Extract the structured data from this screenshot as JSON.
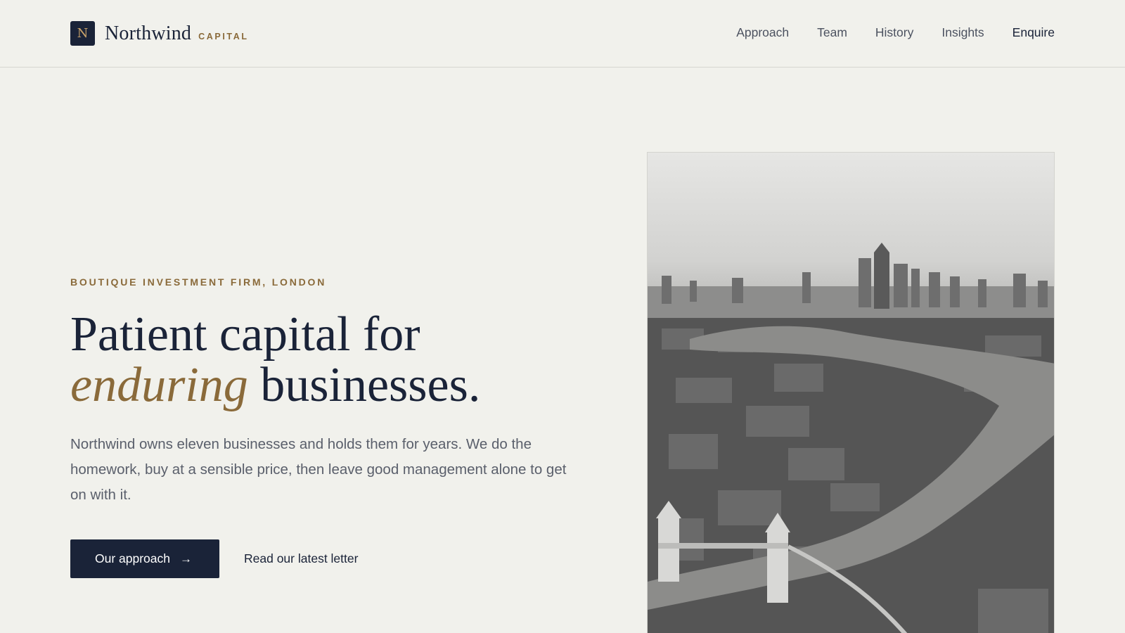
{
  "header": {
    "logo_letter": "N",
    "brand_name": "Northwind",
    "brand_sub": "CAPITAL",
    "nav": [
      {
        "label": "Approach"
      },
      {
        "label": "Team"
      },
      {
        "label": "History"
      },
      {
        "label": "Insights"
      },
      {
        "label": "Enquire"
      }
    ]
  },
  "hero": {
    "eyebrow": "BOUTIQUE INVESTMENT FIRM, LONDON",
    "headline_line1": "Patient capital for",
    "headline_accent": "enduring",
    "headline_line2_rest": " businesses.",
    "lead": "Northwind owns eleven businesses and holds them for years. We do the homework, buy at a sensible price, then leave good management alone to get on with it.",
    "primary_cta": "Our approach",
    "secondary_cta": "Read our latest letter"
  },
  "colors": {
    "navy": "#1a2338",
    "gold": "#8a6a3a",
    "background": "#f1f1ec"
  },
  "icons": {
    "cta_arrow": "arrow-right-icon"
  }
}
